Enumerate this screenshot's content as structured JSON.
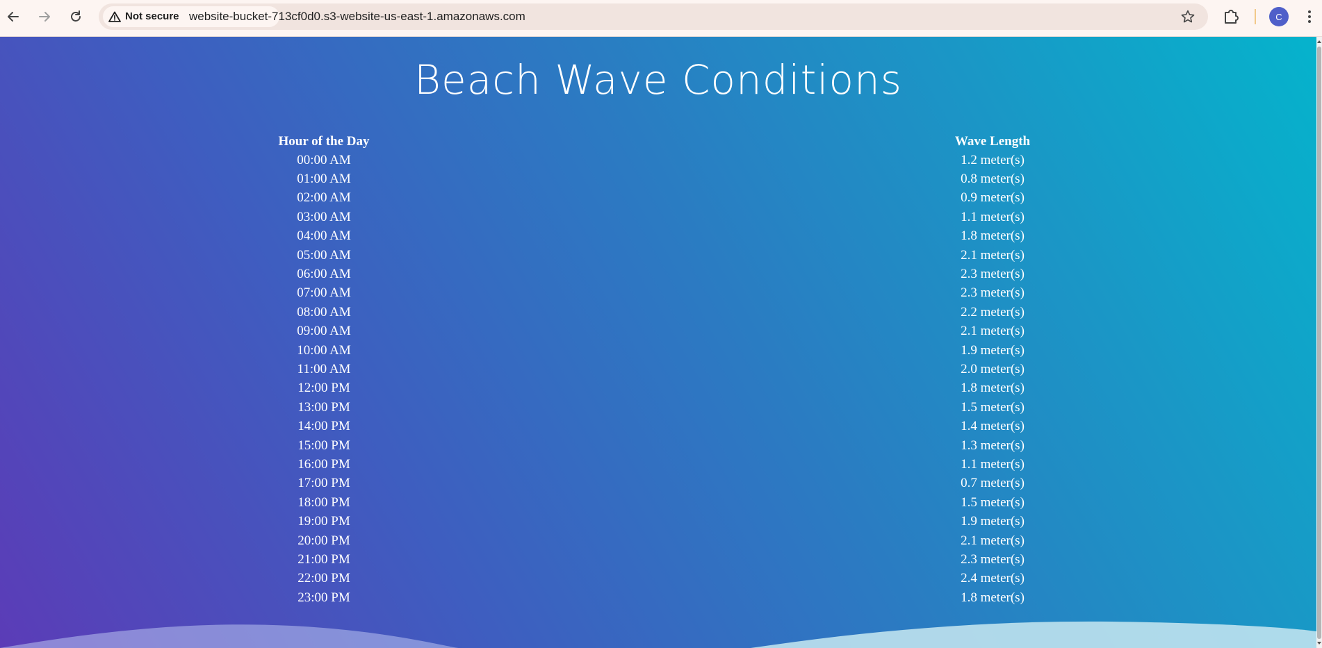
{
  "browser": {
    "security_label": "Not secure",
    "url": "website-bucket-713cf0d0.s3-website-us-east-1.amazonaws.com",
    "avatar_letter": "C"
  },
  "page": {
    "title": "Beach Wave Conditions",
    "columns": [
      "Hour of the Day",
      "Wave Length"
    ],
    "rows": [
      [
        "00:00 AM",
        "1.2 meter(s)"
      ],
      [
        "01:00 AM",
        "0.8 meter(s)"
      ],
      [
        "02:00 AM",
        "0.9 meter(s)"
      ],
      [
        "03:00 AM",
        "1.1 meter(s)"
      ],
      [
        "04:00 AM",
        "1.8 meter(s)"
      ],
      [
        "05:00 AM",
        "2.1 meter(s)"
      ],
      [
        "06:00 AM",
        "2.3 meter(s)"
      ],
      [
        "07:00 AM",
        "2.3 meter(s)"
      ],
      [
        "08:00 AM",
        "2.2 meter(s)"
      ],
      [
        "09:00 AM",
        "2.1 meter(s)"
      ],
      [
        "10:00 AM",
        "1.9 meter(s)"
      ],
      [
        "11:00 AM",
        "2.0 meter(s)"
      ],
      [
        "12:00 PM",
        "1.8 meter(s)"
      ],
      [
        "13:00 PM",
        "1.5 meter(s)"
      ],
      [
        "14:00 PM",
        "1.4 meter(s)"
      ],
      [
        "15:00 PM",
        "1.3 meter(s)"
      ],
      [
        "16:00 PM",
        "1.1 meter(s)"
      ],
      [
        "17:00 PM",
        "0.7 meter(s)"
      ],
      [
        "18:00 PM",
        "1.5 meter(s)"
      ],
      [
        "19:00 PM",
        "1.9 meter(s)"
      ],
      [
        "20:00 PM",
        "2.1 meter(s)"
      ],
      [
        "21:00 PM",
        "2.3 meter(s)"
      ],
      [
        "22:00 PM",
        "2.4 meter(s)"
      ],
      [
        "23:00 PM",
        "1.8 meter(s)"
      ]
    ]
  },
  "colors": {
    "gradient_start": "#5b3cb7",
    "gradient_end": "#05b3cc",
    "text": "#ffffff",
    "chrome_background": "#fdf5f2",
    "omnibox": "#f1e4df",
    "avatar": "#4f5fc9"
  },
  "icons": {
    "back": "arrow-left-icon",
    "forward": "arrow-right-icon",
    "reload": "reload-icon",
    "security": "warning-triangle-icon",
    "bookmark": "star-icon",
    "extensions": "puzzle-piece-icon",
    "menu": "three-dots-vertical-icon"
  }
}
